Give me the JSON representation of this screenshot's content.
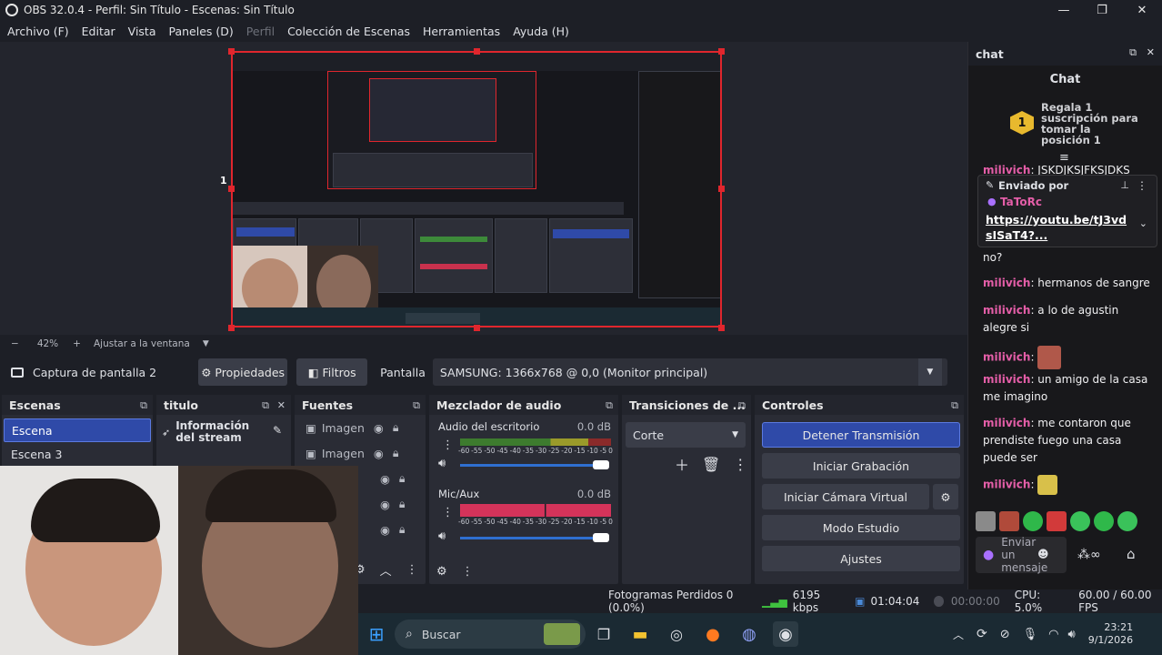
{
  "window": {
    "title": "OBS 32.0.4 - Perfil: Sin Título - Escenas: Sin Título",
    "minimize": "—",
    "maximize": "❐",
    "close": "✕"
  },
  "menu": [
    "Archivo (F)",
    "Editar",
    "Vista",
    "Paneles (D)",
    "Perfil",
    "Colección de Escenas",
    "Herramientas",
    "Ayuda (H)"
  ],
  "preview": {
    "px_label": "1 px"
  },
  "zoom": {
    "minus": "−",
    "value": "42%",
    "plus": "+",
    "fit_label": "Ajustar a la ventana",
    "dropdown": "▼"
  },
  "sourcebar": {
    "source_name": "Captura de pantalla 2",
    "properties": "Propiedades",
    "filters": "Filtros",
    "display_label": "Pantalla",
    "display_value": "SAMSUNG: 1366x768 @ 0,0 (Monitor principal)"
  },
  "scenes": {
    "title": "Escenas",
    "items": [
      "Escena",
      "Escena 3"
    ]
  },
  "titulo": {
    "title": "titulo",
    "item": "Información del stream"
  },
  "sources": {
    "title": "Fuentes",
    "items": [
      "Imagen",
      "Imagen"
    ]
  },
  "mixer": {
    "title": "Mezclador de audio",
    "channels": [
      {
        "name": "Audio del escritorio",
        "level": "0.0 dB"
      },
      {
        "name": "Mic/Aux",
        "level": "0.0 dB"
      }
    ],
    "scale": [
      "-60",
      "-55",
      "-50",
      "-45",
      "-40",
      "-35",
      "-30",
      "-25",
      "-20",
      "-15",
      "-10",
      "-5",
      "0"
    ]
  },
  "transitions": {
    "title": "Transiciones de ...",
    "value": "Corte"
  },
  "controls": {
    "title": "Controles",
    "stop_stream": "Detener Transmisión",
    "start_recording": "Iniciar Grabación",
    "virtual_cam": "Iniciar Cámara Virtual",
    "studio_mode": "Modo Estudio",
    "settings": "Ajustes"
  },
  "status": {
    "dropped": "Fotogramas Perdidos 0 (0.0%)",
    "bitrate": "6195 kbps",
    "stream_time": "01:04:04",
    "rec_time": "00:00:00",
    "cpu": "CPU: 5.0%",
    "fps": "60.00 / 60.00 FPS"
  },
  "chat": {
    "dock_title": "chat",
    "header": "Chat",
    "gift": {
      "rank": "1",
      "text": "Regala 1 suscripción para tomar la posición 1"
    },
    "pinned": {
      "cut_line_user": "milivich",
      "cut_line_text": ": JSKDJKSJFKSJDKS",
      "label": "Enviado por",
      "author": "TaToRc",
      "link": "https://youtu.be/tJ3vd sISaT4?...",
      "tail": "no?"
    },
    "messages": [
      {
        "user": "milivich",
        "text": ": hermanos de sangre"
      },
      {
        "user": "milivich",
        "text": ": a lo de agustin alegre si"
      },
      {
        "user": "milivich",
        "text": ":"
      },
      {
        "user": "milivich",
        "text": ": un amigo de la casa me imagino"
      },
      {
        "user": "milivich",
        "text": ": me contaron que prendiste fuego una casa puede ser"
      },
      {
        "user": "milivich",
        "text": ":"
      }
    ],
    "input_placeholder": "Enviar un mensaje"
  },
  "taskbar": {
    "search": "Buscar",
    "time": "23:21",
    "date": "9/1/2026"
  },
  "colors": {
    "accent": "#2f4aa8",
    "red": "#e0262d",
    "chat_user": "#e45ea8",
    "panel": "#2a2c35"
  }
}
